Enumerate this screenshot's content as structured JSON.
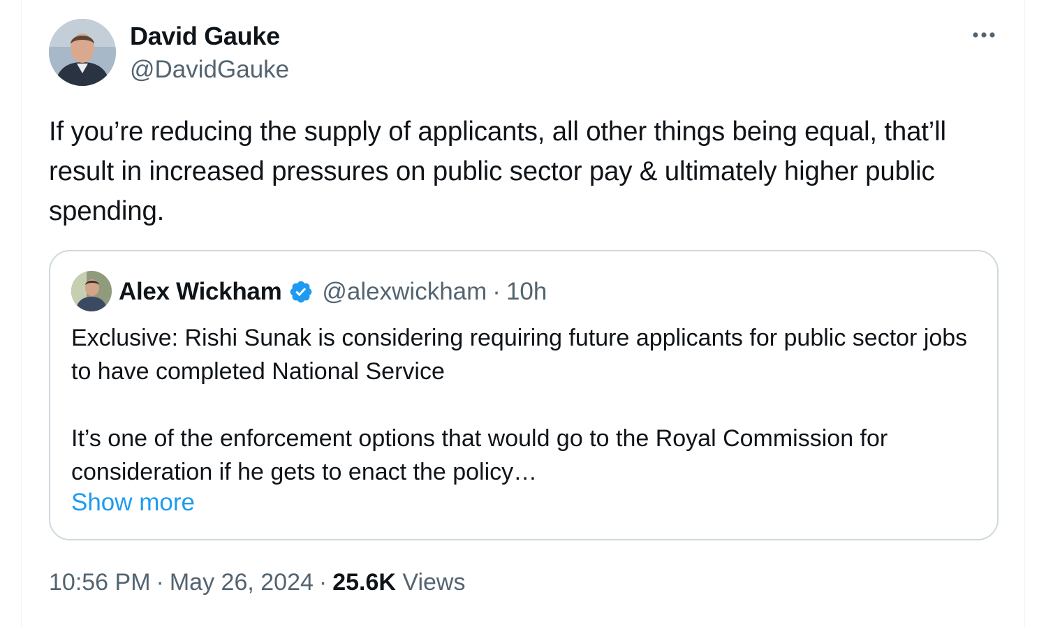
{
  "author": {
    "display_name": "David Gauke",
    "handle": "@DavidGauke"
  },
  "tweet": {
    "text": "If you’re reducing the supply of applicants, all other things being equal, that’ll result in increased pressures on public sector pay & ultimately higher public spending."
  },
  "quoted_tweet": {
    "display_name": "Alex Wickham",
    "handle": "@alexwickham",
    "separator": "·",
    "time": "10h",
    "paragraph_1": "Exclusive: Rishi Sunak is considering requiring future applicants for public sector jobs to have completed National Service",
    "paragraph_2": "It’s one of the enforcement options that would go to the Royal Commission for consideration if he gets to enact the policy…",
    "show_more": "Show more"
  },
  "meta": {
    "time": "10:56 PM",
    "separator": "·",
    "date": "May 26, 2024",
    "views_count": "25.6K",
    "views_label": "Views"
  },
  "icons": {
    "more": "more-horizontal-icon",
    "verified": "verified-badge-icon"
  },
  "colors": {
    "text_primary": "#0f1419",
    "text_secondary": "#536471",
    "link": "#1d9bf0",
    "border": "#cfd9de"
  }
}
